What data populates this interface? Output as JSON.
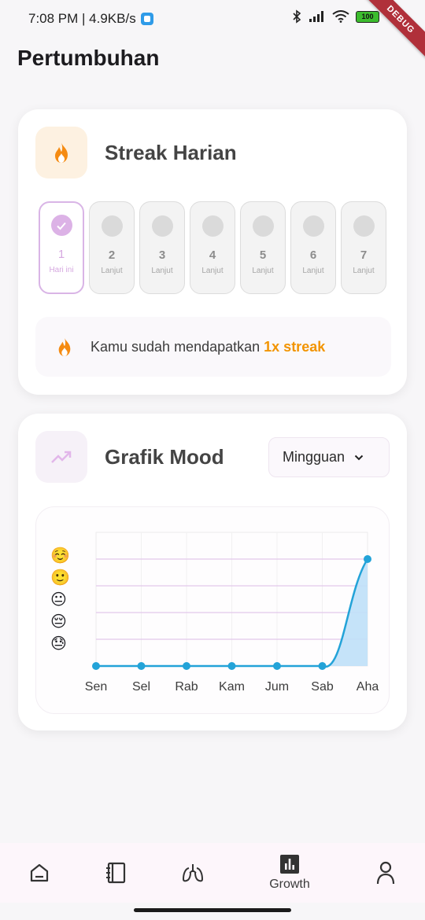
{
  "status_bar": {
    "time_speed": "7:08 PM | 4.9KB/s",
    "battery": "100",
    "debug": "DEBUG"
  },
  "page_title": "Pertumbuhan",
  "streak": {
    "title": "Streak Harian",
    "days": [
      {
        "num": "1",
        "sub": "Hari ini",
        "done": true
      },
      {
        "num": "2",
        "sub": "Lanjut",
        "done": false
      },
      {
        "num": "3",
        "sub": "Lanjut",
        "done": false
      },
      {
        "num": "4",
        "sub": "Lanjut",
        "done": false
      },
      {
        "num": "5",
        "sub": "Lanjut",
        "done": false
      },
      {
        "num": "6",
        "sub": "Lanjut",
        "done": false
      },
      {
        "num": "7",
        "sub": "Lanjut",
        "done": false
      }
    ],
    "message": "Kamu sudah mendapatkan",
    "highlight": "1x streak"
  },
  "mood": {
    "title": "Grafik Mood",
    "period": "Mingguan",
    "emojis": [
      "☺️",
      "🙂",
      "😐",
      "😔",
      "😓"
    ]
  },
  "chart_data": {
    "type": "area",
    "categories": [
      "Sen",
      "Sel",
      "Rab",
      "Kam",
      "Jum",
      "Sab",
      "Aha"
    ],
    "values": [
      0,
      0,
      0,
      0,
      0,
      0,
      4
    ],
    "ylim": [
      0,
      5
    ],
    "grid": true,
    "colors": {
      "line": "#23a3d8",
      "fill": "#bfe0f8",
      "grid": "#e3c8ec"
    }
  },
  "bottom_nav": {
    "items": [
      {
        "icon": "home-icon",
        "label": ""
      },
      {
        "icon": "journal-icon",
        "label": ""
      },
      {
        "icon": "lungs-icon",
        "label": ""
      },
      {
        "icon": "growth-icon",
        "label": "Growth"
      },
      {
        "icon": "profile-icon",
        "label": ""
      }
    ]
  }
}
